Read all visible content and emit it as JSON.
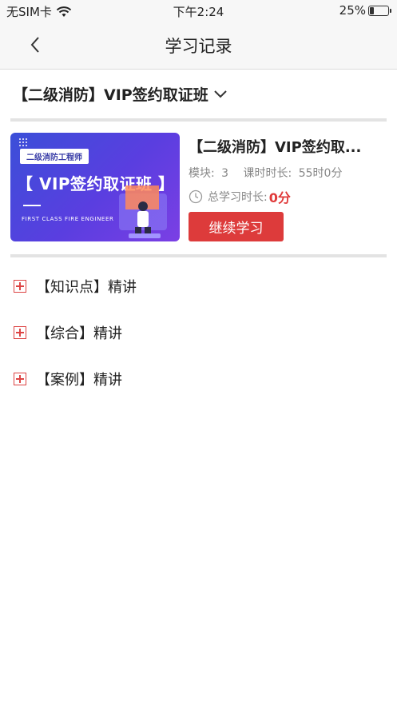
{
  "status_bar": {
    "carrier": "无SIM卡",
    "time": "下午2:24",
    "battery": "25%"
  },
  "nav": {
    "title": "学习记录"
  },
  "course_selector": {
    "label": "【二级消防】VIP签约取证班"
  },
  "course_card": {
    "cover": {
      "tag": "二级消防工程师",
      "headline": "【 VIP签约取证班 】",
      "subtitle": "FIRST CLASS FIRE ENGINEER"
    },
    "title": "【二级消防】VIP签约取...",
    "modules_label": "模块:",
    "modules_value": "3",
    "hours_label": "课时时长:",
    "hours_value": "55时0分",
    "study_label": "总学习时长:",
    "study_value": "0分",
    "continue_label": "继续学习",
    "accent_color": "#dd3b3b"
  },
  "sections": [
    {
      "label": "【知识点】精讲"
    },
    {
      "label": "【综合】精讲"
    },
    {
      "label": "【案例】精讲"
    }
  ]
}
